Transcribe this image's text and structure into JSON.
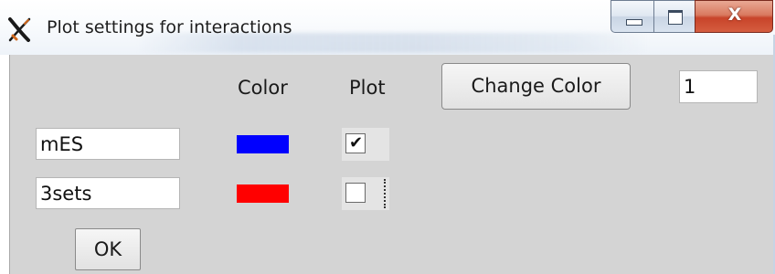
{
  "window": {
    "title": "Plot settings for interactions",
    "close_glyph": "X"
  },
  "headers": {
    "color": "Color",
    "plot": "Plot"
  },
  "buttons": {
    "change_color": "Change Color",
    "ok": "OK"
  },
  "count_field": {
    "value": "1"
  },
  "rows": [
    {
      "name": "mES",
      "color": "#0000ff",
      "plot_checked": true,
      "check_glyph": "✔"
    },
    {
      "name": "3sets",
      "color": "#ff0000",
      "plot_checked": false,
      "check_glyph": ""
    }
  ],
  "icons": {
    "app": "x-app-icon",
    "minimize": "minimize-icon",
    "maximize": "maximize-icon",
    "close": "close-icon"
  },
  "colors": {
    "client_bg": "#d4d4d4",
    "close_button": "#c8442a"
  }
}
